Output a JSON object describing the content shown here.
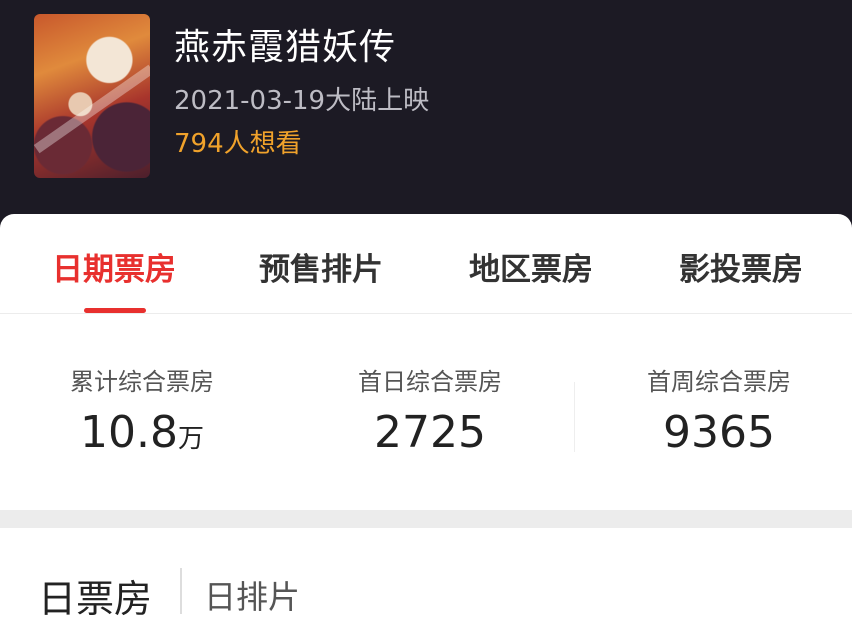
{
  "movie": {
    "title": "燕赤霞猎妖传",
    "release": "2021-03-19大陆上映",
    "want": "794人想看"
  },
  "tabs": [
    {
      "label": "日期票房",
      "active": true
    },
    {
      "label": "预售排片",
      "active": false
    },
    {
      "label": "地区票房",
      "active": false
    },
    {
      "label": "影投票房",
      "active": false
    }
  ],
  "stats": [
    {
      "label": "累计综合票房",
      "value": "10.8",
      "unit": "万"
    },
    {
      "label": "首日综合票房",
      "value": "2725",
      "unit": ""
    },
    {
      "label": "首周综合票房",
      "value": "9365",
      "unit": ""
    }
  ],
  "section": {
    "tab_main": "日票房",
    "tab_second": "日排片"
  },
  "colors": {
    "header_bg": "#1c1a24",
    "accent_red": "#e8302e",
    "want_orange": "#f0a22b"
  }
}
